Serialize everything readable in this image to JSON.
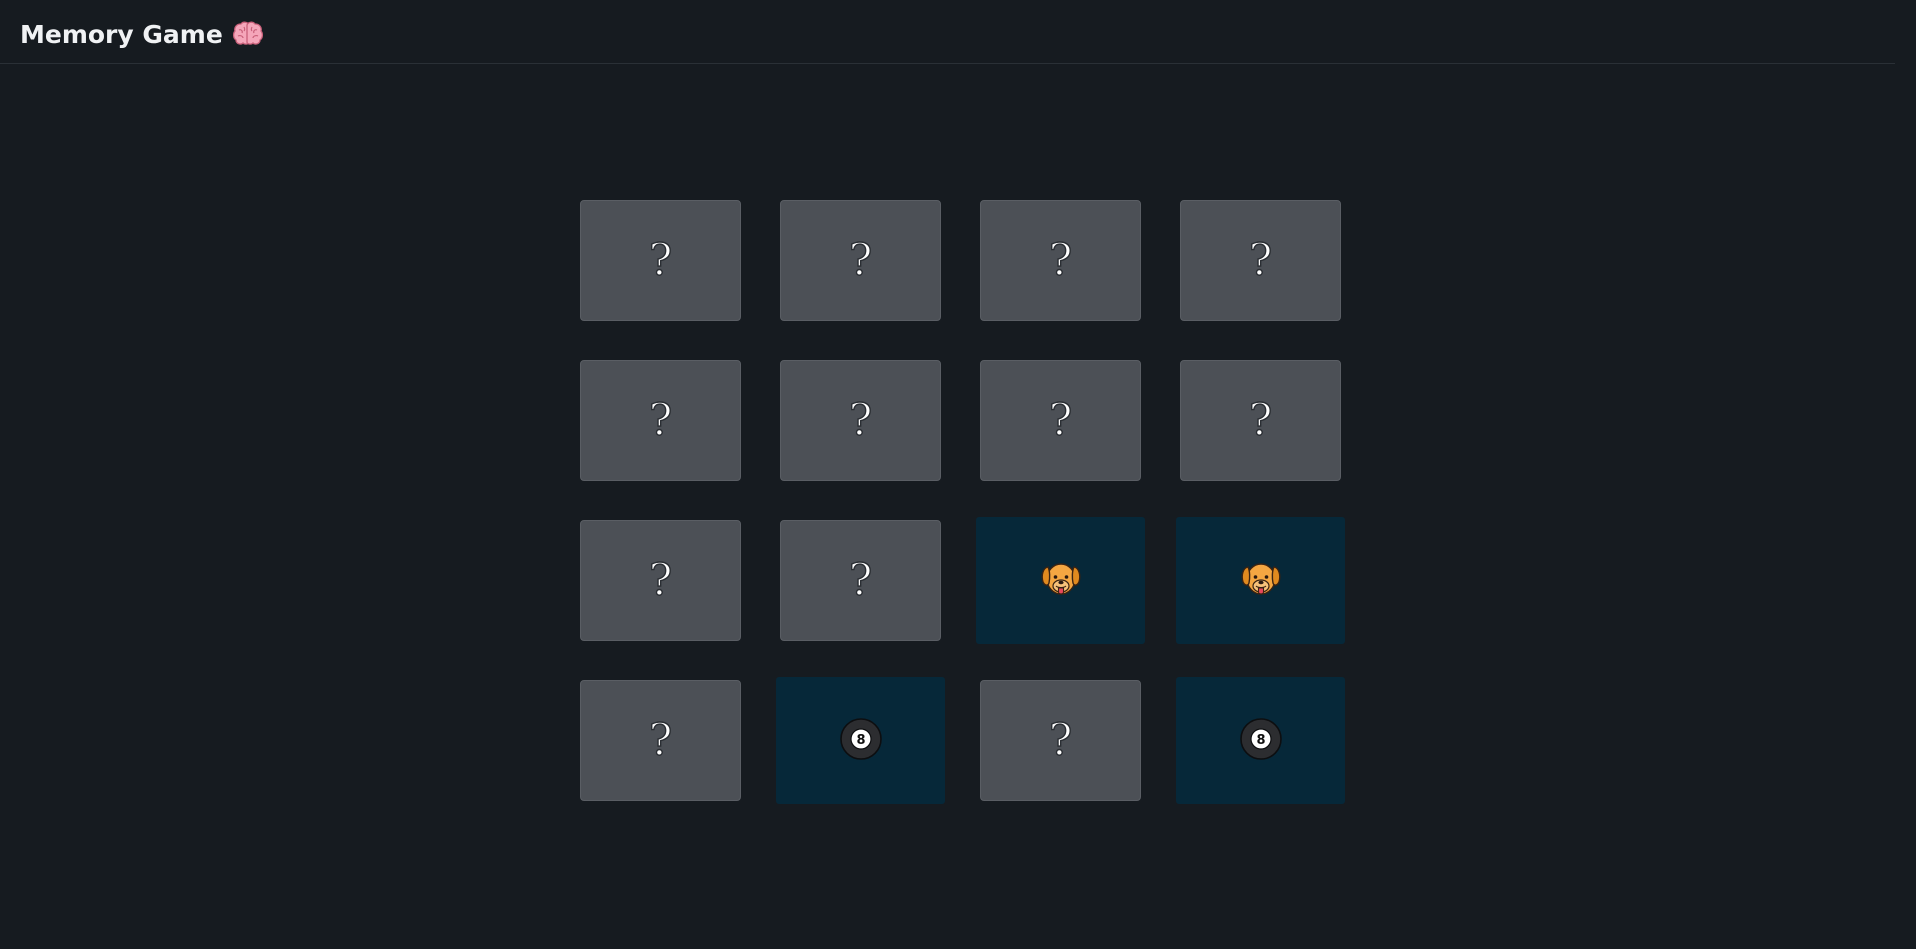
{
  "header": {
    "title": "Memory Game",
    "title_icon": "brain-icon"
  },
  "board": {
    "rows": 4,
    "columns": 4,
    "cards": [
      {
        "state": "hidden",
        "symbol": "?"
      },
      {
        "state": "hidden",
        "symbol": "?"
      },
      {
        "state": "hidden",
        "symbol": "?"
      },
      {
        "state": "hidden",
        "symbol": "?"
      },
      {
        "state": "hidden",
        "symbol": "?"
      },
      {
        "state": "hidden",
        "symbol": "?"
      },
      {
        "state": "hidden",
        "symbol": "?"
      },
      {
        "state": "hidden",
        "symbol": "?"
      },
      {
        "state": "hidden",
        "symbol": "?"
      },
      {
        "state": "hidden",
        "symbol": "?"
      },
      {
        "state": "revealed",
        "icon": "dog-face-icon"
      },
      {
        "state": "revealed",
        "icon": "dog-face-icon"
      },
      {
        "state": "hidden",
        "symbol": "?"
      },
      {
        "state": "revealed",
        "icon": "eight-ball-icon",
        "label": "8"
      },
      {
        "state": "hidden",
        "symbol": "?"
      },
      {
        "state": "revealed",
        "icon": "eight-ball-icon",
        "label": "8"
      }
    ]
  },
  "colors": {
    "background": "#161b20",
    "card_hidden": "#4c5056",
    "card_revealed": "#062839",
    "title_text": "#f0f2f4"
  }
}
